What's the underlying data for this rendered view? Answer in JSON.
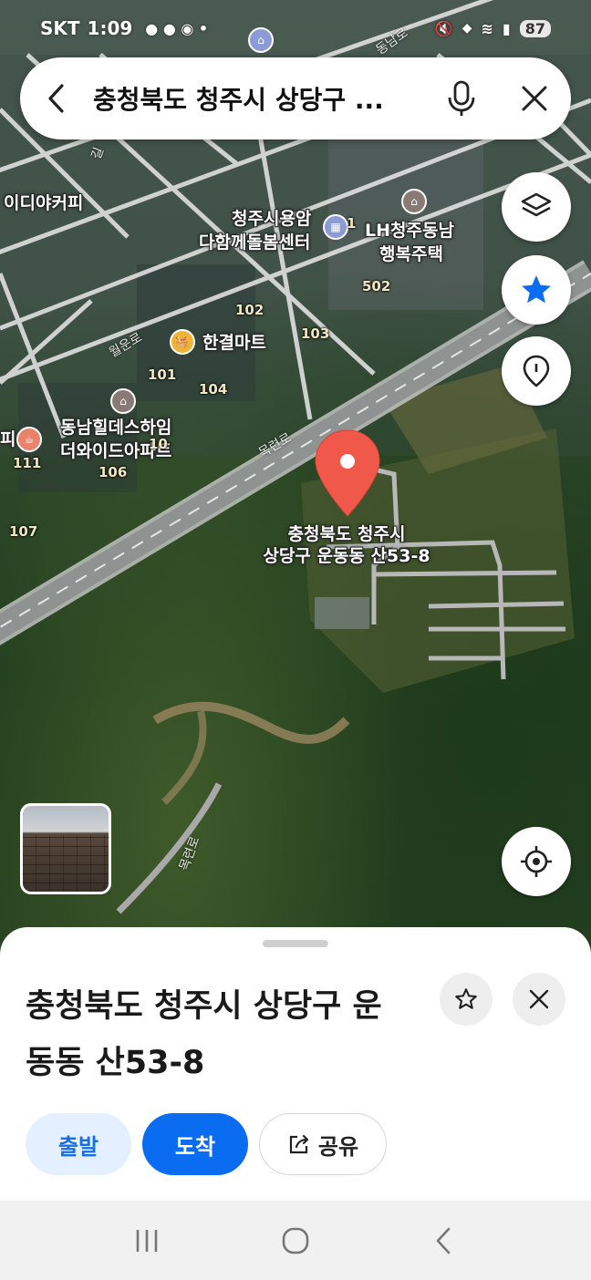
{
  "status_bar": {
    "carrier": "SKT",
    "time": "1:09",
    "battery": "87"
  },
  "search": {
    "query": "충청북도 청주시 상당구 ..."
  },
  "map": {
    "poi_labels": {
      "cafe_left": "이디야커피",
      "care_center_line1": "청주시용암",
      "care_center_line2": "다함께돌봄센터",
      "lh_line1": "LH청주동남",
      "lh_line2": "행복주택",
      "mart": "한결마트",
      "apt_line1": "동남힐데스하임",
      "apt_line2": "더와이드아파트",
      "cafe_edge": "피"
    },
    "building_numbers": {
      "b502": "502",
      "b102": "102",
      "b103": "103",
      "b101": "101",
      "b104": "104",
      "b111": "111",
      "b106": "106",
      "b107": "107",
      "b10x": "10",
      "b1": "1"
    },
    "road_labels": {
      "wolun": "월운로",
      "mokryeon": "목련로",
      "mokryeon2": "목련로",
      "dongnam": "동남로",
      "gil": "길"
    },
    "pin_label_line1": "충청북도 청주시",
    "pin_label_line2": "상당구 운동동 산53-8"
  },
  "place": {
    "title": "충청북도 청주시 상당구 운동동 산53-8"
  },
  "actions": {
    "depart": "출발",
    "arrive": "도착",
    "share": "공유"
  },
  "colors": {
    "accent": "#0A6CF0",
    "pin": "#F0584A"
  },
  "icons": {
    "back": "chevron-left-icon",
    "mic": "mic-icon",
    "clear": "close-icon",
    "layers": "layers-icon",
    "favorites": "star-icon",
    "pin": "location-pin-icon",
    "locate": "crosshair-icon"
  }
}
